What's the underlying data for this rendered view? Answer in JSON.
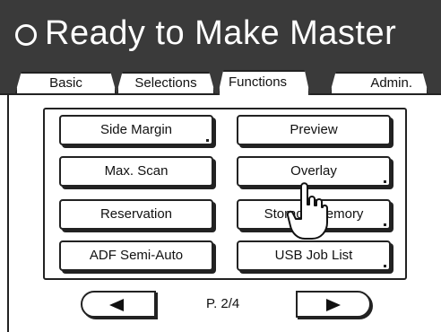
{
  "header": {
    "title": "Ready to Make Master",
    "status_icon": "ring-icon"
  },
  "tabs": [
    {
      "label": "Basic"
    },
    {
      "label": "Selections"
    },
    {
      "label": "Functions",
      "active": true
    },
    {
      "label": "Admin."
    }
  ],
  "functions": {
    "left": [
      {
        "label": "Side Margin"
      },
      {
        "label": "Max. Scan"
      },
      {
        "label": "Reservation"
      },
      {
        "label": "ADF Semi-Auto"
      }
    ],
    "right": [
      {
        "label": "Preview"
      },
      {
        "label": "Overlay"
      },
      {
        "label": "Storage Memory"
      },
      {
        "label": "USB Job List"
      }
    ]
  },
  "pager": {
    "page_label": "P. 2/4",
    "prev_icon": "left-triangle-icon",
    "next_icon": "right-triangle-icon"
  },
  "pointer": {
    "icon": "hand-pointer-icon"
  },
  "colors": {
    "header_bg": "#3a3a3a",
    "ink": "#222222",
    "paper": "#ffffff"
  }
}
